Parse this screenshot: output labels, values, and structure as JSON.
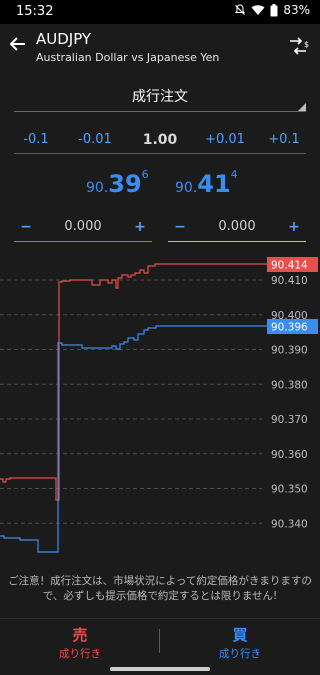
{
  "status": {
    "time": "15:32",
    "battery": "83%"
  },
  "header": {
    "symbol": "AUDJPY",
    "description": "Australian Dollar vs Japanese Yen"
  },
  "order_type": {
    "label": "成行注文"
  },
  "lot": {
    "buttons": [
      "-0.1",
      "-0.01",
      "+0.01",
      "+0.1"
    ],
    "value": "1.00"
  },
  "prices": {
    "bid": {
      "prefix": "90.",
      "big": "39",
      "sup": "6"
    },
    "ask": {
      "prefix": "90.",
      "big": "41",
      "sup": "4"
    }
  },
  "slippage": {
    "sell": {
      "minus": "−",
      "value": "0.000",
      "plus": "+"
    },
    "buy": {
      "minus": "−",
      "value": "0.000",
      "plus": "+"
    }
  },
  "chart_data": {
    "type": "line",
    "y_ticks": [
      "90.410",
      "90.400",
      "90.390",
      "90.380",
      "90.370",
      "90.360",
      "90.350",
      "90.340"
    ],
    "series": [
      {
        "color": "#e3504d",
        "last_label": "90.414"
      },
      {
        "color": "#3a8df0",
        "last_label": "90.396"
      }
    ],
    "grid": "dashed horizontal"
  },
  "notice": "ご注意！成行注文は、市場状況によって約定価格がきまりますので、必ずしも提示価格で約定するとは限りません!",
  "trade": {
    "sell": {
      "main": "売",
      "sub": "成り行き"
    },
    "buy": {
      "main": "買",
      "sub": "成り行き"
    }
  }
}
